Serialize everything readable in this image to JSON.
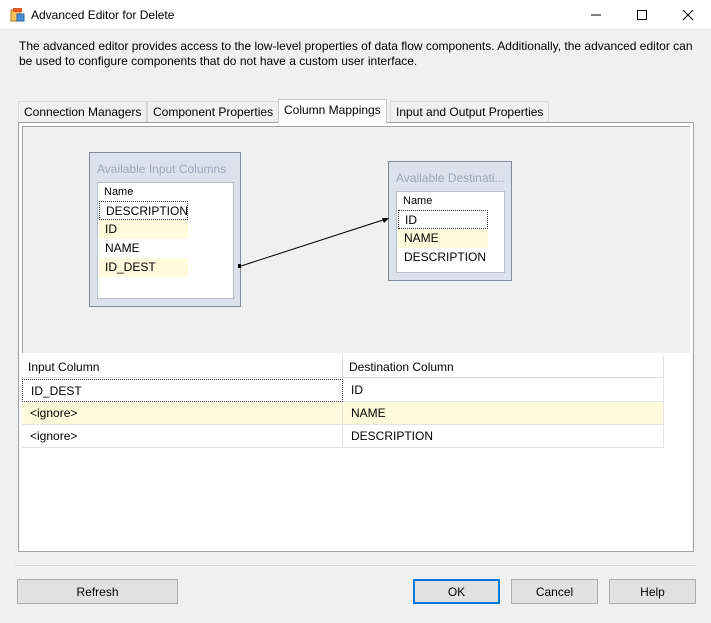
{
  "window": {
    "title": "Advanced Editor for Delete"
  },
  "description": "The advanced editor provides access to the low-level properties of data flow components. Additionally, the advanced editor can be used to configure components that do not have a custom user interface.",
  "tabs": [
    {
      "label": "Connection Managers"
    },
    {
      "label": "Component Properties"
    },
    {
      "label": "Column Mappings",
      "active": true
    },
    {
      "label": "Input and Output Properties"
    }
  ],
  "input_columns": {
    "title": "Available Input Columns",
    "header": "Name",
    "items": [
      "DESCRIPTION",
      "ID",
      "NAME",
      "ID_DEST"
    ]
  },
  "destination_columns": {
    "title": "Available Destinati...",
    "header": "Name",
    "items": [
      "ID",
      "NAME",
      "DESCRIPTION"
    ]
  },
  "mapping_grid": {
    "headers": [
      "Input Column",
      "Destination Column"
    ],
    "rows": [
      {
        "input": "ID_DEST",
        "destination": "ID"
      },
      {
        "input": "<ignore>",
        "destination": "NAME"
      },
      {
        "input": "<ignore>",
        "destination": "DESCRIPTION"
      }
    ]
  },
  "buttons": {
    "refresh": "Refresh",
    "ok": "OK",
    "cancel": "Cancel",
    "help": "Help"
  },
  "colors": {
    "highlight_row": "#fffbdc",
    "focus_blue": "#0078d7",
    "diagram_bg": "#f0f0f0"
  }
}
